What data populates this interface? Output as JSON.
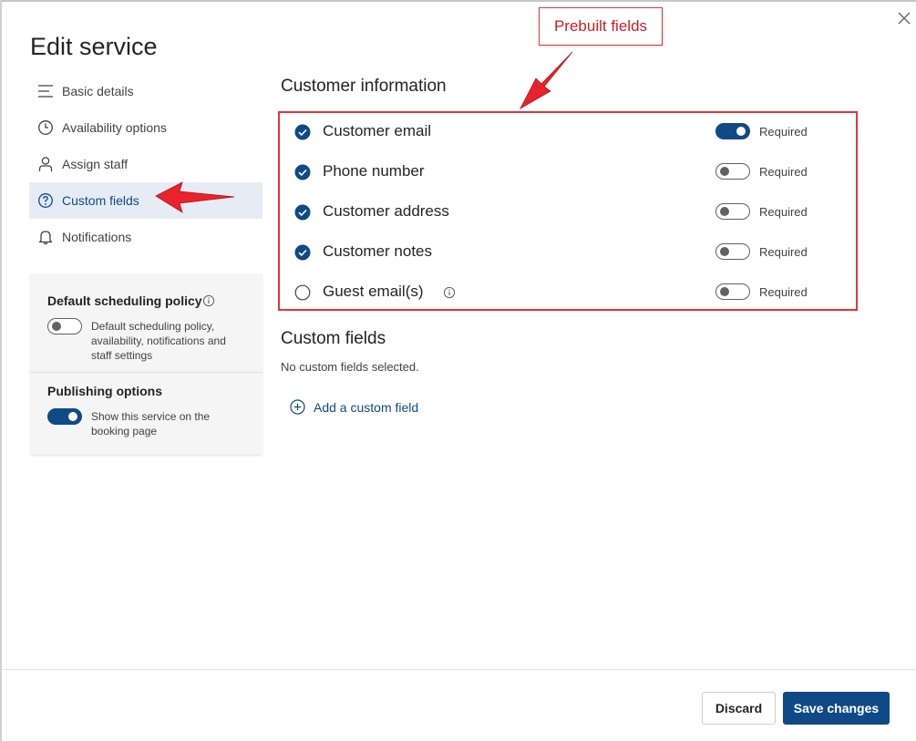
{
  "dialog": {
    "title": "Edit service",
    "close_icon": "close-icon"
  },
  "nav": {
    "items": [
      {
        "label": "Basic details",
        "icon": "lines-icon"
      },
      {
        "label": "Availability options",
        "icon": "clock-icon"
      },
      {
        "label": "Assign staff",
        "icon": "person-icon"
      },
      {
        "label": "Custom fields",
        "icon": "question-circle-icon",
        "active": true
      },
      {
        "label": "Notifications",
        "icon": "bell-icon"
      }
    ]
  },
  "policy": {
    "default_title": "Default scheduling policy",
    "default_desc": "Default scheduling policy, availability, notifications and staff settings",
    "default_toggle_on": false,
    "publishing_title": "Publishing options",
    "publishing_desc": "Show this service on the booking page",
    "publishing_toggle_on": true
  },
  "customer_info": {
    "title": "Customer information",
    "required_label": "Required",
    "fields": [
      {
        "label": "Customer email",
        "checked": true,
        "required": true
      },
      {
        "label": "Phone number",
        "checked": true,
        "required": false
      },
      {
        "label": "Customer address",
        "checked": true,
        "required": false
      },
      {
        "label": "Customer notes",
        "checked": true,
        "required": false
      },
      {
        "label": "Guest email(s)",
        "checked": false,
        "required": false,
        "info_icon": true
      }
    ]
  },
  "custom_fields": {
    "title": "Custom fields",
    "empty_text": "No custom fields selected.",
    "add_label": "Add a custom field"
  },
  "annotation": {
    "callout_text": "Prebuilt fields"
  },
  "footer": {
    "discard_label": "Discard",
    "save_label": "Save changes"
  },
  "colors": {
    "accent": "#0f4a86",
    "annotation_red": "#e0353b",
    "active_nav_bg": "#e5ecf5"
  }
}
